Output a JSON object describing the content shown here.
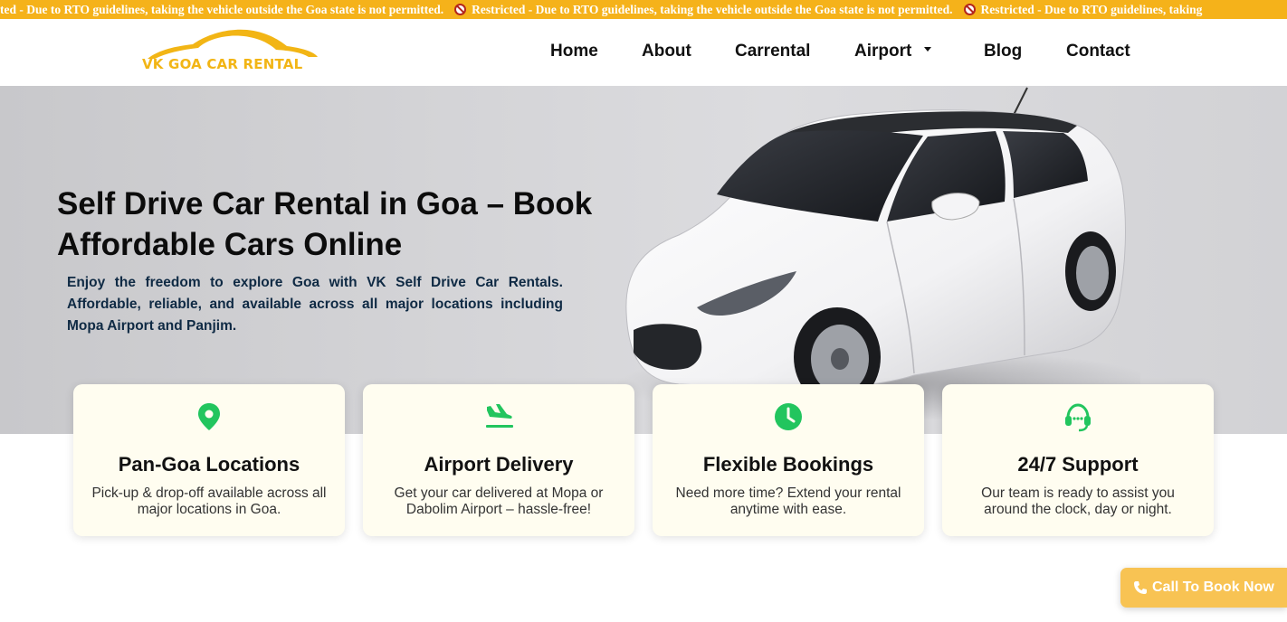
{
  "ticker": {
    "message_partial": "ted - Due to RTO guidelines, taking the vehicle outside the Goa state is not permitted.",
    "message": "Restricted - Due to RTO guidelines, taking the vehicle outside the Goa state is not permitted.",
    "message_tail": "Restricted - Due to RTO guidelines, taking",
    "background": "#f5b21a"
  },
  "header": {
    "logo_text": "VK GOA CAR RENTAL",
    "nav": {
      "home": "Home",
      "about": "About",
      "carrental": "Carrental",
      "airport": "Airport",
      "blog": "Blog",
      "contact": "Contact"
    }
  },
  "hero": {
    "title": "Self Drive Car Rental in Goa – Book Affordable Cars Online",
    "subtitle": "Enjoy the freedom to explore Goa with VK Self Drive Car Rentals. Affordable, reliable, and available across all major locations including Mopa Airport and Panjim."
  },
  "features": [
    {
      "icon": "map-pin-icon",
      "title": "Pan-Goa Locations",
      "text": "Pick-up & drop-off available across all major locations in Goa."
    },
    {
      "icon": "plane-landing-icon",
      "title": "Airport Delivery",
      "text": "Get your car delivered at Mopa or Dabolim Airport – hassle-free!"
    },
    {
      "icon": "clock-icon",
      "title": "Flexible Bookings",
      "text": "Need more time? Extend your rental anytime with ease."
    },
    {
      "icon": "headset-icon",
      "title": "24/7 Support",
      "text": "Our team is ready to assist you around the clock, day or night."
    }
  ],
  "call_button": {
    "label": "Call To Book Now",
    "background": "#f8c353"
  },
  "colors": {
    "accent_green": "#22c55e",
    "logo_yellow": "#f2b515"
  }
}
